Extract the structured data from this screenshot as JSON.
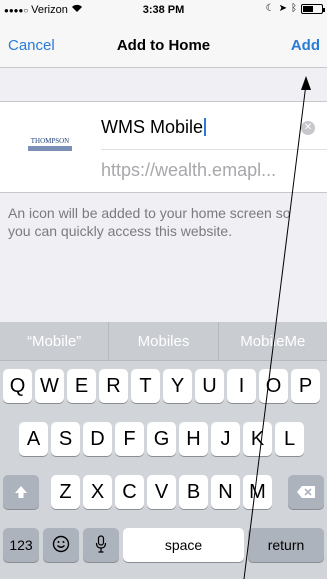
{
  "status_bar": {
    "carrier": "Verizon",
    "time": "3:38 PM"
  },
  "nav": {
    "cancel_label": "Cancel",
    "title": "Add to Home",
    "add_label": "Add"
  },
  "form": {
    "favicon_text": "THOMPSON",
    "name_value": "WMS Mobile",
    "url_value": "https://wealth.emapl..."
  },
  "hint": "An icon will be added to your home screen so you can quickly access this website.",
  "keyboard": {
    "suggestions": [
      "“Mobile”",
      "Mobiles",
      "MobileMe"
    ],
    "row1": [
      "Q",
      "W",
      "E",
      "R",
      "T",
      "Y",
      "U",
      "I",
      "O",
      "P"
    ],
    "row2": [
      "A",
      "S",
      "D",
      "F",
      "G",
      "H",
      "J",
      "K",
      "L"
    ],
    "row3": [
      "Z",
      "X",
      "C",
      "V",
      "B",
      "N",
      "M"
    ],
    "numbers_label": "123",
    "space_label": "space",
    "return_label": "return"
  },
  "colors": {
    "accent": "#2a7bd6",
    "keyboard_bg": "#d1d4d9",
    "page_bg": "#efeff4"
  }
}
